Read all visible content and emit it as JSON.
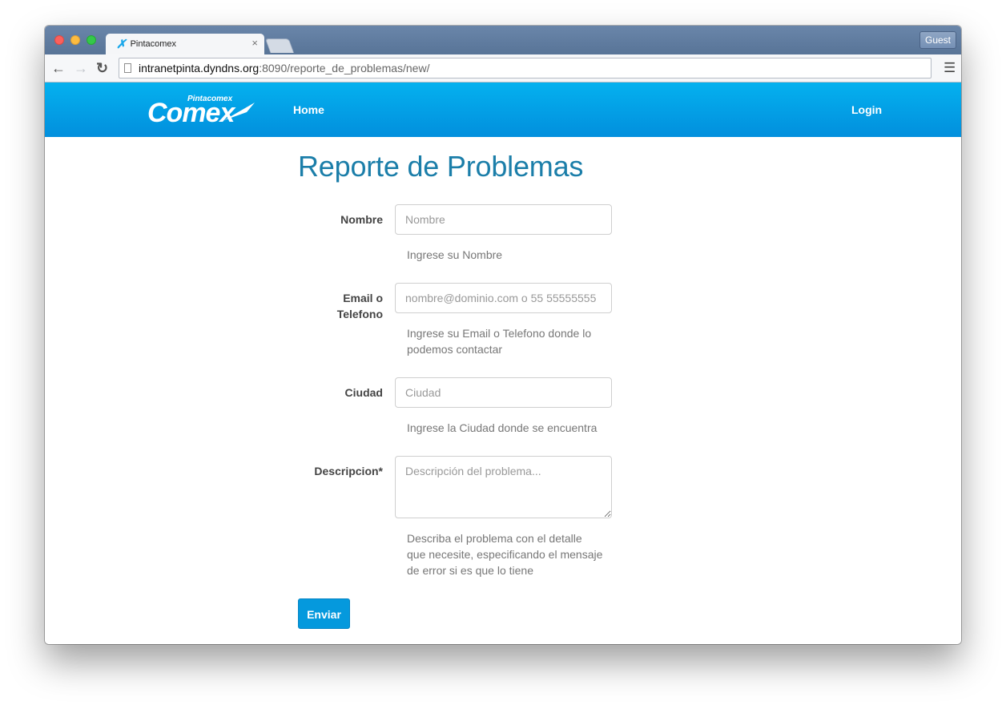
{
  "browser": {
    "tab_title": "Pintacomex",
    "tab_close": "×",
    "guest_label": "Guest",
    "url_host": "intranetpinta.dyndns.org",
    "url_path": ":8090/reporte_de_problemas/new/"
  },
  "navbar": {
    "brand_small": "Pintacomex",
    "brand_big": "Comex",
    "home": "Home",
    "login": "Login"
  },
  "form": {
    "title": "Reporte de Problemas",
    "nombre": {
      "label": "Nombre",
      "placeholder": "Nombre",
      "help": "Ingrese su Nombre"
    },
    "email": {
      "label": "Email o Telefono",
      "placeholder": "nombre@dominio.com o 55 55555555",
      "help": "Ingrese su Email o Telefono donde lo podemos contactar"
    },
    "ciudad": {
      "label": "Ciudad",
      "placeholder": "Ciudad",
      "help": "Ingrese la Ciudad donde se encuentra"
    },
    "descripcion": {
      "label": "Descripcion*",
      "placeholder": "Descripción del problema...",
      "help": "Describa el problema con el detalle que necesite, especificando el mensaje de error si es que lo tiene"
    },
    "submit": "Enviar"
  },
  "icons": {
    "back": "arrow-left-icon",
    "forward": "arrow-right-icon",
    "reload": "reload-icon",
    "page": "page-icon",
    "menu": "hamburger-menu-icon"
  }
}
